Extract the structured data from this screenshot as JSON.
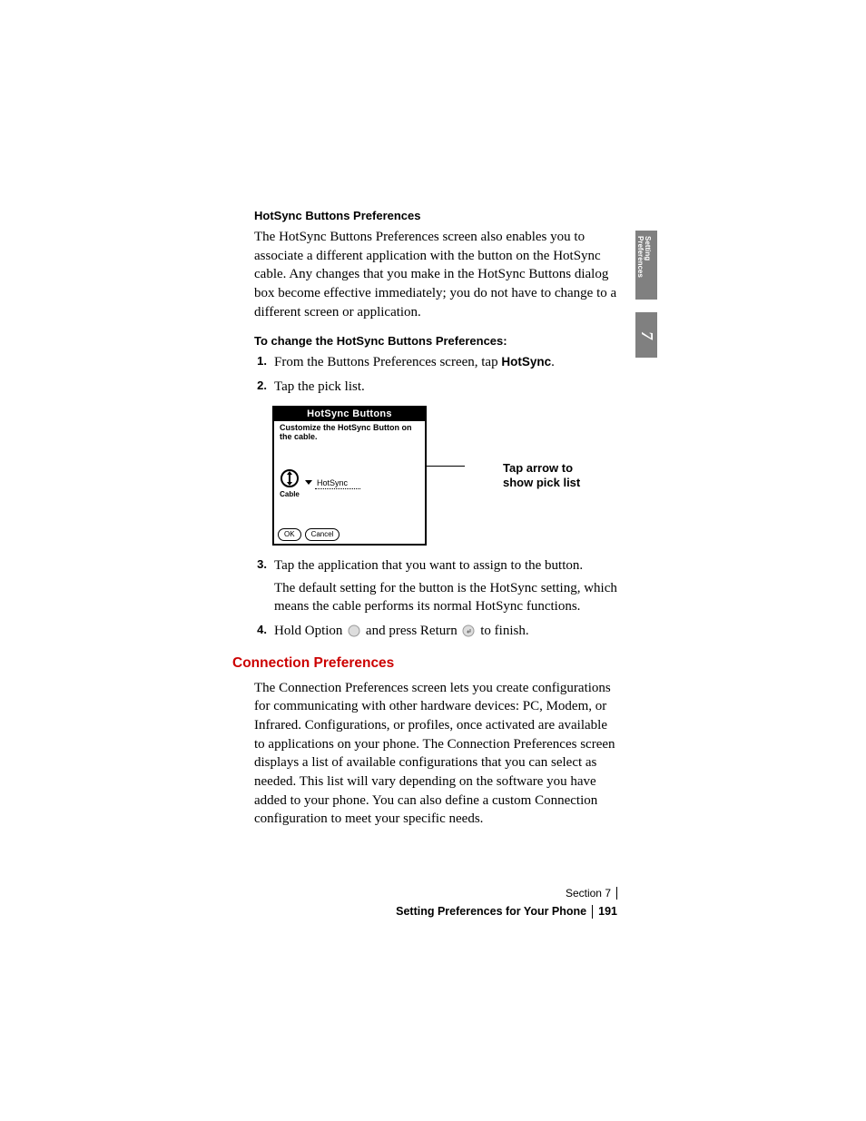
{
  "section": {
    "heading_a": "HotSync Buttons Preferences",
    "para_a": "The HotSync Buttons Preferences screen also enables you to associate a different application with the button on the HotSync cable. Any changes that you make in the HotSync Buttons dialog box become effective immediately; you do not have to change to a different screen or application.",
    "heading_b": "To change the HotSync Buttons Preferences:",
    "steps": [
      {
        "n": "1.",
        "pre": "From the Buttons Preferences screen, tap ",
        "bold": "HotSync",
        "post": "."
      },
      {
        "n": "2.",
        "pre": "Tap the pick list.",
        "bold": "",
        "post": ""
      }
    ],
    "steps2": [
      {
        "n": "3.",
        "line1": "Tap the application that you want to assign to the button.",
        "line2": "The default setting for the button is the HotSync setting, which means the cable performs its normal HotSync functions."
      },
      {
        "n": "4.",
        "line1_pre": "Hold Option ",
        "line1_mid": " and press Return ",
        "line1_post": " to finish."
      }
    ],
    "heading_c": "Connection Preferences",
    "para_c": "The Connection Preferences screen lets you create configurations for communicating with other hardware devices: PC, Modem, or Infrared. Configurations, or profiles, once activated are available to applications on your phone. The Connection Preferences screen displays a list of available configurations that you can select as needed. This list will vary depending on the software you have added to your phone. You can also define a custom Connection configuration to meet your specific needs."
  },
  "figure": {
    "title": "HotSync Buttons",
    "instruction": "Customize the HotSync Button on the cable.",
    "dropdown_value": "HotSync",
    "cable_label": "Cable",
    "ok": "OK",
    "cancel": "Cancel",
    "caption": "Tap arrow to show pick list"
  },
  "sidebar": {
    "text1": "Setting",
    "text2": "Preferences",
    "chapter": "7"
  },
  "footer": {
    "section_label": "Section 7",
    "title": "Setting Preferences for Your Phone",
    "page": "191"
  }
}
